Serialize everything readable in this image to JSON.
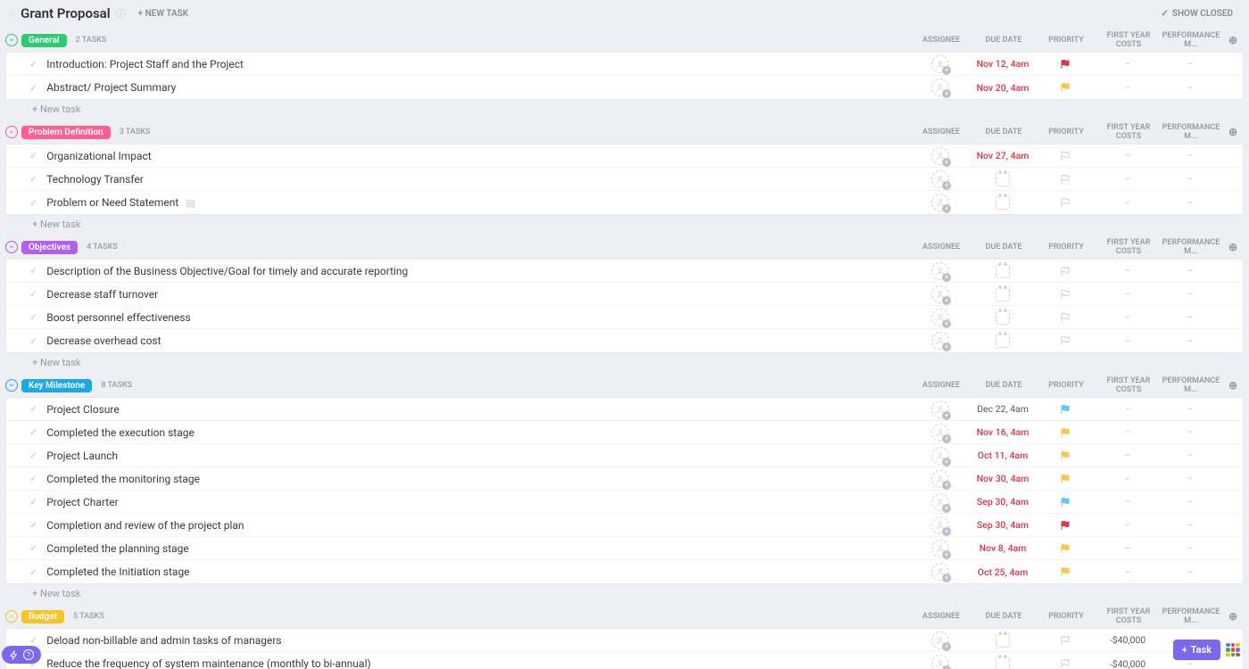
{
  "header": {
    "title": "Grant Proposal",
    "new_task": "+ NEW TASK",
    "show_closed": "SHOW CLOSED"
  },
  "columns": {
    "assignee": "ASSIGNEE",
    "due": "DUE DATE",
    "priority": "PRIORITY",
    "cost": "FIRST YEAR COSTS",
    "perf": "PERFORMANCE M..."
  },
  "misc": {
    "new_task_row": "+ New task",
    "dash": "–",
    "fab_task": "Task"
  },
  "sections": [
    {
      "name": "General",
      "color": "#2ecc71",
      "count": "2 TASKS",
      "tasks": [
        {
          "title": "Introduction: Project Staff and the Project",
          "due": "Nov 12, 4am",
          "due_red": true,
          "priority": "red",
          "cost": "–",
          "perf": "–"
        },
        {
          "title": "Abstract/ Project Summary",
          "due": "Nov 20, 4am",
          "due_red": true,
          "priority": "yellow",
          "cost": "–",
          "perf": "–"
        }
      ],
      "show_new": true
    },
    {
      "name": "Problem Definition",
      "color": "#ff5e93",
      "count": "3 TASKS",
      "tasks": [
        {
          "title": "Organizational Impact",
          "due": "Nov 27, 4am",
          "due_red": true,
          "priority": "empty",
          "cost": "–",
          "perf": "–"
        },
        {
          "title": "Technology Transfer",
          "due": "",
          "priority": "empty",
          "cost": "–",
          "perf": "–"
        },
        {
          "title": "Problem or Need Statement",
          "due": "",
          "priority": "empty",
          "cost": "–",
          "perf": "–",
          "has_doc": true
        }
      ],
      "show_new": true
    },
    {
      "name": "Objectives",
      "color": "#b25ef2",
      "count": "4 TASKS",
      "tasks": [
        {
          "title": "Description of the Business Objective/Goal for timely and accurate reporting",
          "due": "",
          "priority": "empty",
          "cost": "–",
          "perf": "–"
        },
        {
          "title": "Decrease staff turnover",
          "due": "",
          "priority": "empty",
          "cost": "–",
          "perf": "–"
        },
        {
          "title": "Boost personnel effectiveness",
          "due": "",
          "priority": "empty",
          "cost": "–",
          "perf": "–"
        },
        {
          "title": "Decrease overhead cost",
          "due": "",
          "priority": "empty",
          "cost": "–",
          "perf": "–"
        }
      ],
      "show_new": true
    },
    {
      "name": "Key Milestone",
      "color": "#1aa9e8",
      "count": "8 TASKS",
      "tasks": [
        {
          "title": "Project Closure",
          "due": "Dec 22, 4am",
          "due_red": false,
          "priority": "blue",
          "cost": "–",
          "perf": "–"
        },
        {
          "title": "Completed the execution stage",
          "due": "Nov 16, 4am",
          "due_red": true,
          "priority": "yellow",
          "cost": "–",
          "perf": "–"
        },
        {
          "title": "Project Launch",
          "due": "Oct 11, 4am",
          "due_red": true,
          "priority": "yellow",
          "cost": "–",
          "perf": "–"
        },
        {
          "title": "Completed the monitoring stage",
          "due": "Nov 30, 4am",
          "due_red": true,
          "priority": "yellow",
          "cost": "–",
          "perf": "–"
        },
        {
          "title": "Project Charter",
          "due": "Sep 30, 4am",
          "due_red": true,
          "priority": "blue",
          "cost": "–",
          "perf": "–"
        },
        {
          "title": "Completion and review of the project plan",
          "due": "Sep 30, 4am",
          "due_red": true,
          "priority": "red",
          "cost": "–",
          "perf": "–"
        },
        {
          "title": "Completed the planning stage",
          "due": "Nov 8, 4am",
          "due_red": true,
          "priority": "yellow",
          "cost": "–",
          "perf": "–"
        },
        {
          "title": "Completed the Initiation stage",
          "due": "Oct 25, 4am",
          "due_red": true,
          "priority": "yellow",
          "cost": "–",
          "perf": "–"
        }
      ],
      "show_new": true
    },
    {
      "name": "Budget",
      "color": "#f5c526",
      "count": "5 TASKS",
      "tasks": [
        {
          "title": "Deload non-billable and admin tasks of managers",
          "due": "",
          "priority": "empty",
          "cost": "-$40,000",
          "perf": "–"
        },
        {
          "title": "Reduce the frequency of system maintenance (monthly to bi-annual)",
          "due": "",
          "priority": "empty",
          "cost": "-$40,000",
          "perf": "–"
        }
      ],
      "show_new": false
    }
  ]
}
